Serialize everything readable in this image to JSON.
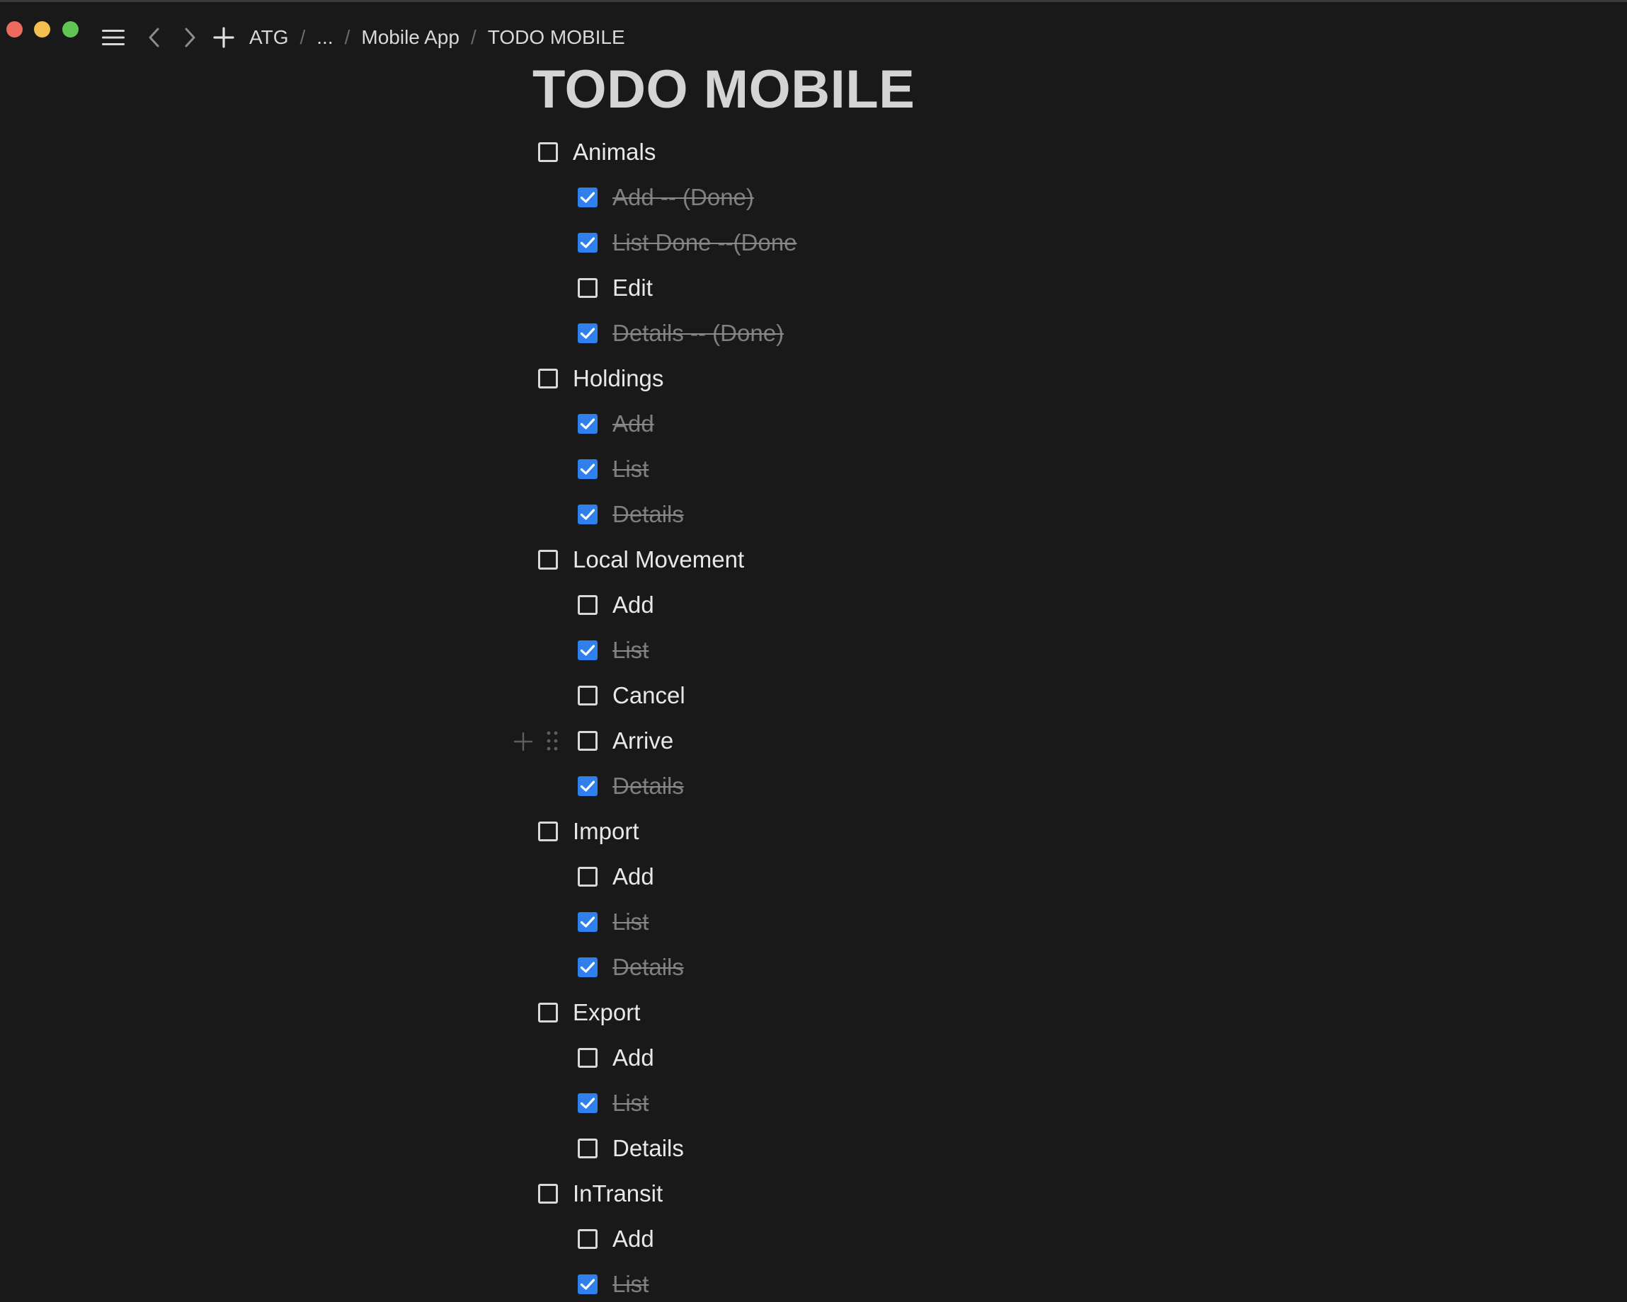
{
  "window": {
    "traffic_lights": [
      "close",
      "minimize",
      "maximize"
    ]
  },
  "toolbar": {
    "icons": [
      "menu-icon",
      "chevron-left-icon",
      "chevron-right-icon",
      "plus-icon"
    ]
  },
  "breadcrumb": {
    "items": [
      "ATG",
      "...",
      "Mobile App",
      "TODO MOBILE"
    ],
    "separator": "/"
  },
  "page": {
    "title": "TODO MOBILE"
  },
  "colors": {
    "background": "#191919",
    "checkbox_checked": "#2f80ed",
    "text": "#e8e8e8",
    "done_text": "#7f7f7f"
  },
  "todos": [
    {
      "label": "Animals",
      "level": 0,
      "checked": false
    },
    {
      "label": "Add -- (Done)",
      "level": 1,
      "checked": true
    },
    {
      "label": "List Done --(Done",
      "level": 1,
      "checked": true
    },
    {
      "label": "Edit",
      "level": 1,
      "checked": false
    },
    {
      "label": "Details -- (Done)",
      "level": 1,
      "checked": true
    },
    {
      "label": "Holdings",
      "level": 0,
      "checked": false
    },
    {
      "label": "Add",
      "level": 1,
      "checked": true
    },
    {
      "label": "List",
      "level": 1,
      "checked": true
    },
    {
      "label": "Details",
      "level": 1,
      "checked": true
    },
    {
      "label": "Local Movement",
      "level": 0,
      "checked": false
    },
    {
      "label": "Add",
      "level": 1,
      "checked": false
    },
    {
      "label": "List",
      "level": 1,
      "checked": true
    },
    {
      "label": "Cancel",
      "level": 1,
      "checked": false
    },
    {
      "label": "Arrive",
      "level": 1,
      "checked": false,
      "hovered": true
    },
    {
      "label": "Details",
      "level": 1,
      "checked": true
    },
    {
      "label": "Import",
      "level": 0,
      "checked": false
    },
    {
      "label": "Add",
      "level": 1,
      "checked": false
    },
    {
      "label": "List",
      "level": 1,
      "checked": true
    },
    {
      "label": "Details",
      "level": 1,
      "checked": true
    },
    {
      "label": "Export",
      "level": 0,
      "checked": false
    },
    {
      "label": "Add",
      "level": 1,
      "checked": false
    },
    {
      "label": "List",
      "level": 1,
      "checked": true
    },
    {
      "label": "Details",
      "level": 1,
      "checked": false
    },
    {
      "label": "InTransit",
      "level": 0,
      "checked": false
    },
    {
      "label": "Add",
      "level": 1,
      "checked": false
    },
    {
      "label": "List",
      "level": 1,
      "checked": true
    }
  ]
}
